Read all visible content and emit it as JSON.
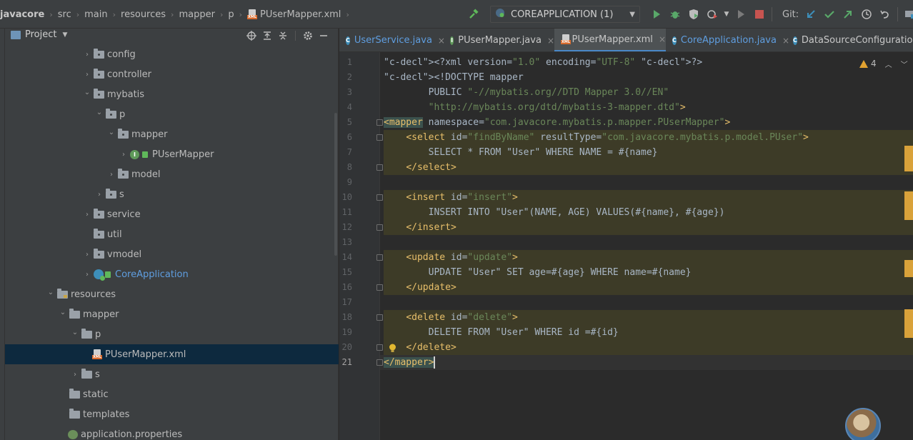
{
  "breadcrumb": {
    "items": [
      "javacore",
      "src",
      "main",
      "resources",
      "mapper",
      "p"
    ],
    "file": "PUserMapper.xml"
  },
  "toolbar": {
    "run_config": "COREAPPLICATION (1)",
    "git_label": "Git:"
  },
  "project_panel": {
    "title": "Project",
    "tree": [
      {
        "label": "config",
        "type": "package",
        "depth": 0,
        "arrow": "›",
        "color": "default"
      },
      {
        "label": "controller",
        "type": "package",
        "depth": 0,
        "arrow": "›",
        "color": "default"
      },
      {
        "label": "mybatis",
        "type": "package",
        "depth": 0,
        "arrow": "⌄",
        "color": "default"
      },
      {
        "label": "p",
        "type": "package",
        "depth": 1,
        "arrow": "⌄",
        "color": "default"
      },
      {
        "label": "mapper",
        "type": "package",
        "depth": 2,
        "arrow": "⌄",
        "color": "default"
      },
      {
        "label": "PUserMapper",
        "type": "interface",
        "depth": 3,
        "arrow": "›",
        "color": "default"
      },
      {
        "label": "model",
        "type": "package",
        "depth": 2,
        "arrow": "›",
        "color": "default"
      },
      {
        "label": "s",
        "type": "package",
        "depth": 1,
        "arrow": "›",
        "color": "default"
      },
      {
        "label": "service",
        "type": "package",
        "depth": 0,
        "arrow": "›",
        "color": "default"
      },
      {
        "label": "util",
        "type": "package",
        "depth": 0,
        "arrow": "",
        "color": "default"
      },
      {
        "label": "vmodel",
        "type": "package",
        "depth": 0,
        "arrow": "›",
        "color": "default"
      },
      {
        "label": "CoreApplication",
        "type": "spring-class",
        "depth": 0,
        "arrow": "›",
        "color": "blue"
      },
      {
        "label": "resources",
        "type": "resources",
        "depth": -3,
        "arrow": "⌄",
        "color": "default"
      },
      {
        "label": "mapper",
        "type": "folder",
        "depth": -2,
        "arrow": "⌄",
        "color": "default"
      },
      {
        "label": "p",
        "type": "folder",
        "depth": -1,
        "arrow": "⌄",
        "color": "default"
      },
      {
        "label": "PUserMapper.xml",
        "type": "xml",
        "depth": 0,
        "arrow": "",
        "color": "default",
        "selected": true
      },
      {
        "label": "s",
        "type": "folder",
        "depth": -1,
        "arrow": "›",
        "color": "default"
      },
      {
        "label": "static",
        "type": "folder",
        "depth": -2,
        "arrow": "",
        "color": "default"
      },
      {
        "label": "templates",
        "type": "folder",
        "depth": -2,
        "arrow": "",
        "color": "default"
      },
      {
        "label": "application.properties",
        "type": "properties",
        "depth": -2,
        "arrow": "",
        "color": "default"
      }
    ]
  },
  "tabs": [
    {
      "label": "UserService.java",
      "icon": "class",
      "color": "blue",
      "active": false
    },
    {
      "label": "PUserMapper.java",
      "icon": "interface",
      "color": "gray",
      "active": false
    },
    {
      "label": "PUserMapper.xml",
      "icon": "xml",
      "color": "gray",
      "active": true
    },
    {
      "label": "CoreApplication.java",
      "icon": "spring",
      "color": "blue",
      "active": false
    },
    {
      "label": "DataSourceConfiguration.java",
      "icon": "class",
      "color": "gray",
      "active": false
    }
  ],
  "editor": {
    "warning_count": "4",
    "lines": [
      "<?xml version=\"1.0\" encoding=\"UTF-8\" ?>",
      "<!DOCTYPE mapper",
      "        PUBLIC \"-//mybatis.org//DTD Mapper 3.0//EN\"",
      "        \"http://mybatis.org/dtd/mybatis-3-mapper.dtd\">",
      "<mapper namespace=\"com.javacore.mybatis.p.mapper.PUserMapper\">",
      "    <select id=\"findByName\" resultType=\"com.javacore.mybatis.p.model.PUser\">",
      "        SELECT * FROM \"User\" WHERE NAME = #{name}",
      "    </select>",
      "",
      "    <insert id=\"insert\">",
      "        INSERT INTO \"User\"(NAME, AGE) VALUES(#{name}, #{age})",
      "    </insert>",
      "",
      "    <update id=\"update\">",
      "        UPDATE \"User\" SET age=#{age} WHERE name=#{name}",
      "    </update>",
      "",
      "    <delete id=\"delete\">",
      "        DELETE FROM \"User\" WHERE id =#{id}",
      "    </delete>",
      "</mapper>"
    ]
  },
  "colors": {
    "accent": "#4a88c7",
    "selection": "#0d293e",
    "highlight": "#3d3b27",
    "warning": "#e2a230"
  }
}
